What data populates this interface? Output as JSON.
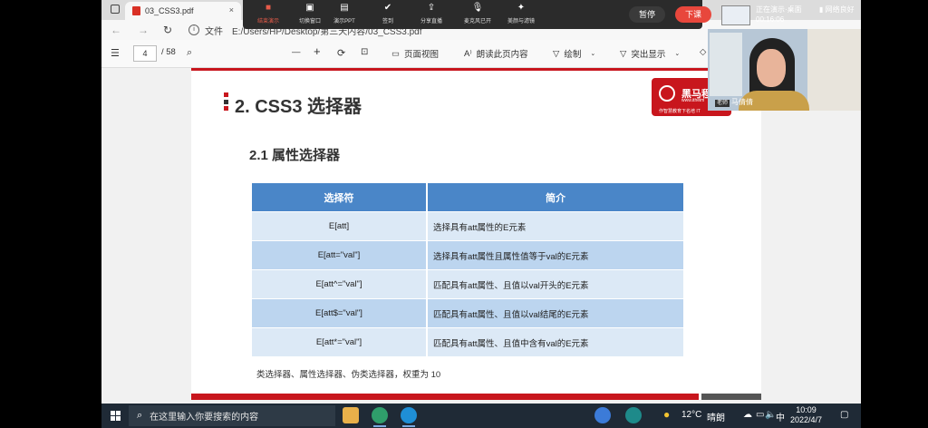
{
  "browser": {
    "tab_title": "03_CSS3.pdf",
    "tab_close": "×",
    "nav_back": "←",
    "nav_forward": "→",
    "reload": "↻",
    "address_label": "文件",
    "address_value": "E:/Users/HP/Desktop/第三天内容/03_CSS3.pdf"
  },
  "pdf_toolbar": {
    "page_current": "4",
    "page_total": "/ 58",
    "search_icon": "⌕",
    "zoom_out": "—",
    "zoom_in": "+",
    "page_view": "页面视图",
    "read_aloud": "朗读此页内容",
    "draw": "绘制",
    "highlight": "突出显示"
  },
  "meeting": {
    "buttons": [
      {
        "label": "结束演示",
        "icon": "■"
      },
      {
        "label": "切换窗口",
        "icon": "▣"
      },
      {
        "label": "演示PPT",
        "icon": "▤"
      },
      {
        "label": "签到",
        "icon": "✔"
      },
      {
        "label": "分享直播",
        "icon": "⇪"
      },
      {
        "label": "麦克风已开",
        "icon": "🎙"
      },
      {
        "label": "美颜与滤镜",
        "icon": "✦"
      }
    ],
    "pause_label": "暂停",
    "leave_label": "下课",
    "presenting_line1": "正在演示·桌面",
    "presenting_timer": "00:16:06",
    "network": "网络良好",
    "teacher_role": "老师",
    "teacher_name": "马倩倩"
  },
  "slide": {
    "heading1": "2. CSS3 选择器",
    "heading2": "2.1 属性选择器",
    "logo_name": "黑马程",
    "logo_url": "www.itheim",
    "logo_slogan": "作智慧教育下名培 IT",
    "table": {
      "headers": [
        "选择符",
        "简介"
      ],
      "rows": [
        [
          "E[att]",
          "选择具有att属性的E元素"
        ],
        [
          "E[att=\"val\"]",
          "选择具有att属性且属性值等于val的E元素"
        ],
        [
          "E[att^=\"val\"]",
          "匹配具有att属性、且值以val开头的E元素"
        ],
        [
          "E[att$=\"val\"]",
          "匹配具有att属性、且值以val结尾的E元素"
        ],
        [
          "E[att*=\"val\"]",
          "匹配具有att属性、且值中含有val的E元素"
        ]
      ]
    },
    "note": "类选择器、属性选择器、伪类选择器，权重为 10"
  },
  "taskbar": {
    "search_placeholder": "在这里输入你要搜索的内容",
    "weather_temp": "12°C",
    "weather_text": "晴朗",
    "ime": "中",
    "time": "10:09",
    "date": "2022/4/7"
  },
  "colors": {
    "brand_red": "#c8161d",
    "table_header": "#4a86c8",
    "row_light": "#dce9f6",
    "row_dark": "#bcd5ef"
  }
}
